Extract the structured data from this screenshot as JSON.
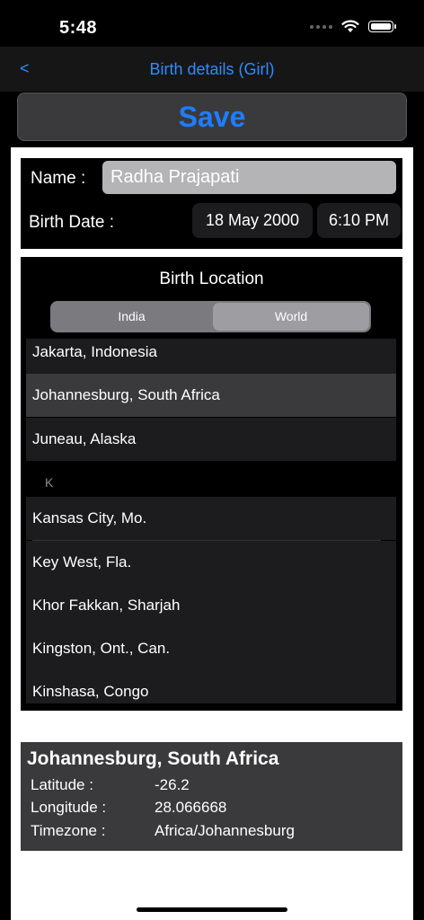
{
  "status": {
    "time": "5:48"
  },
  "nav": {
    "back_label": "<",
    "title": "Birth details (Girl)"
  },
  "save_label": "Save",
  "form": {
    "name_label": "Name :",
    "name_value": "Radha Prajapati",
    "birth_date_label": "Birth Date :",
    "date_value": "18 May 2000",
    "time_value": "6:10 PM"
  },
  "location": {
    "title": "Birth Location",
    "segments": [
      "India",
      "World"
    ],
    "selected_segment": "World",
    "section_header": "K",
    "items_j": [
      "Jakarta, Indonesia",
      "Johannesburg, South Africa",
      "Juneau, Alaska"
    ],
    "items_k": [
      "Kansas City, Mo.",
      "Key West, Fla.",
      "Khor Fakkan, Sharjah",
      "Kingston, Ont., Can.",
      "Kinshasa, Congo"
    ],
    "selected_item": "Johannesburg, South Africa"
  },
  "info": {
    "place": "Johannesburg, South Africa",
    "latitude_label": "Latitude :",
    "latitude": "-26.2",
    "longitude_label": "Longitude :",
    "longitude": "28.066668",
    "timezone_label": "Timezone :",
    "timezone": "Africa/Johannesburg"
  }
}
